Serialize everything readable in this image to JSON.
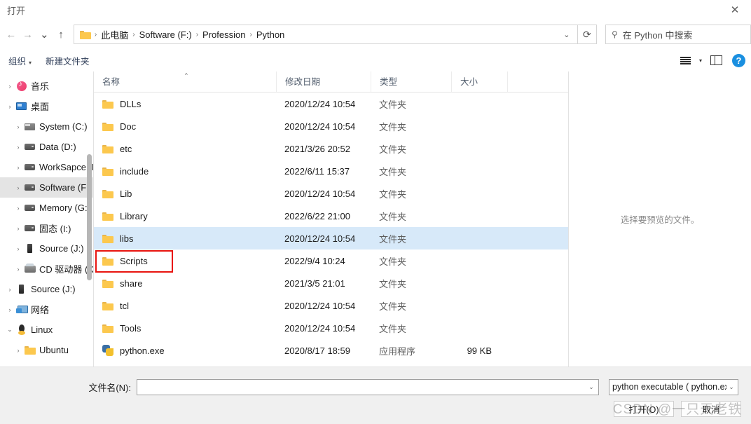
{
  "window": {
    "title": "打开",
    "close_label": "✕"
  },
  "nav": {
    "back_icon": "←",
    "forward_icon": "→",
    "recent_icon": "⌄",
    "up_icon": "↑",
    "address_chevron": "⌄",
    "refresh_icon": "⟳",
    "folder_icon": "folder-icon",
    "breadcrumbs": [
      {
        "label": "此电脑"
      },
      {
        "label": "Software (F:)"
      },
      {
        "label": "Profession"
      },
      {
        "label": "Python"
      }
    ],
    "separator": "›"
  },
  "search": {
    "icon": "search-icon",
    "placeholder": "在 Python 中搜索"
  },
  "commandbar": {
    "organize_label": "组织",
    "organize_caret": "▾",
    "new_folder_label": "新建文件夹",
    "view_icon": "list-view-icon",
    "view_caret": "▾",
    "preview_pane_icon": "preview-pane-icon",
    "help_label": "?"
  },
  "sidebar": {
    "items": [
      {
        "label": "音乐",
        "icon": "music-icon",
        "twisty": "›",
        "indent": false,
        "selected": false
      },
      {
        "label": "桌面",
        "icon": "desktop-icon",
        "twisty": "›",
        "indent": false,
        "selected": false
      },
      {
        "label": "System (C:)",
        "icon": "cdrive-icon",
        "twisty": "›",
        "indent": true,
        "selected": false
      },
      {
        "label": "Data (D:)",
        "icon": "drive-icon",
        "twisty": "›",
        "indent": true,
        "selected": false
      },
      {
        "label": "WorkSapce (E:)",
        "icon": "drive-icon",
        "twisty": "›",
        "indent": true,
        "selected": false
      },
      {
        "label": "Software (F:)",
        "icon": "drive-icon",
        "twisty": "›",
        "indent": true,
        "selected": true
      },
      {
        "label": "Memory (G:)",
        "icon": "drive-icon",
        "twisty": "›",
        "indent": true,
        "selected": false
      },
      {
        "label": "固态 (I:)",
        "icon": "drive-icon",
        "twisty": "›",
        "indent": true,
        "selected": false
      },
      {
        "label": "Source (J:)",
        "icon": "hdd-icon",
        "twisty": "›",
        "indent": true,
        "selected": false
      },
      {
        "label": "CD 驱动器 (K:)",
        "icon": "cd-icon",
        "twisty": "›",
        "indent": true,
        "selected": false
      },
      {
        "label": "Source (J:)",
        "icon": "hdd-icon",
        "twisty": "›",
        "indent": false,
        "selected": false
      },
      {
        "label": "网络",
        "icon": "network-icon",
        "twisty": "›",
        "indent": false,
        "selected": false
      },
      {
        "label": "Linux",
        "icon": "linux-icon",
        "twisty": "⌄",
        "indent": false,
        "selected": false
      },
      {
        "label": "Ubuntu",
        "icon": "folder-icon",
        "twisty": "›",
        "indent": true,
        "selected": false
      }
    ]
  },
  "filelist": {
    "columns": [
      {
        "label": "名称",
        "sorted": true,
        "caret": "^"
      },
      {
        "label": "修改日期",
        "sorted": false,
        "caret": ""
      },
      {
        "label": "类型",
        "sorted": false,
        "caret": ""
      },
      {
        "label": "大小",
        "sorted": false,
        "caret": ""
      }
    ],
    "rows": [
      {
        "name": "DLLs",
        "icon": "folder-icon",
        "date": "2020/12/24 10:54",
        "type": "文件夹",
        "size": "",
        "selected": false,
        "annotated": false
      },
      {
        "name": "Doc",
        "icon": "folder-icon",
        "date": "2020/12/24 10:54",
        "type": "文件夹",
        "size": "",
        "selected": false,
        "annotated": false
      },
      {
        "name": "etc",
        "icon": "folder-icon",
        "date": "2021/3/26 20:52",
        "type": "文件夹",
        "size": "",
        "selected": false,
        "annotated": false
      },
      {
        "name": "include",
        "icon": "folder-icon",
        "date": "2022/6/11 15:37",
        "type": "文件夹",
        "size": "",
        "selected": false,
        "annotated": false
      },
      {
        "name": "Lib",
        "icon": "folder-icon",
        "date": "2020/12/24 10:54",
        "type": "文件夹",
        "size": "",
        "selected": false,
        "annotated": false
      },
      {
        "name": "Library",
        "icon": "folder-icon",
        "date": "2022/6/22 21:00",
        "type": "文件夹",
        "size": "",
        "selected": false,
        "annotated": false
      },
      {
        "name": "libs",
        "icon": "folder-icon",
        "date": "2020/12/24 10:54",
        "type": "文件夹",
        "size": "",
        "selected": true,
        "annotated": false
      },
      {
        "name": "Scripts",
        "icon": "folder-icon",
        "date": "2022/9/4 10:24",
        "type": "文件夹",
        "size": "",
        "selected": false,
        "annotated": true
      },
      {
        "name": "share",
        "icon": "folder-icon",
        "date": "2021/3/5 21:01",
        "type": "文件夹",
        "size": "",
        "selected": false,
        "annotated": false
      },
      {
        "name": "tcl",
        "icon": "folder-icon",
        "date": "2020/12/24 10:54",
        "type": "文件夹",
        "size": "",
        "selected": false,
        "annotated": false
      },
      {
        "name": "Tools",
        "icon": "folder-icon",
        "date": "2020/12/24 10:54",
        "type": "文件夹",
        "size": "",
        "selected": false,
        "annotated": false
      },
      {
        "name": "python.exe",
        "icon": "python-icon",
        "date": "2020/8/17 18:59",
        "type": "应用程序",
        "size": "99 KB",
        "selected": false,
        "annotated": false
      }
    ]
  },
  "preview": {
    "empty_text": "选择要预览的文件。"
  },
  "footer": {
    "filename_label": "文件名(N):",
    "filename_value": "",
    "filename_caret": "⌄",
    "filetype_value": "python executable ( python.exe",
    "filetype_caret": "⌄",
    "open_button": "打开(O)",
    "cancel_button": "取消"
  },
  "watermark": {
    "text": "CSDN @一只天老铁"
  },
  "colors": {
    "selection": "#d7e9f9",
    "annotation": "#e8140f",
    "accent": "#1a8fe0",
    "folder": "#fcc84e"
  }
}
